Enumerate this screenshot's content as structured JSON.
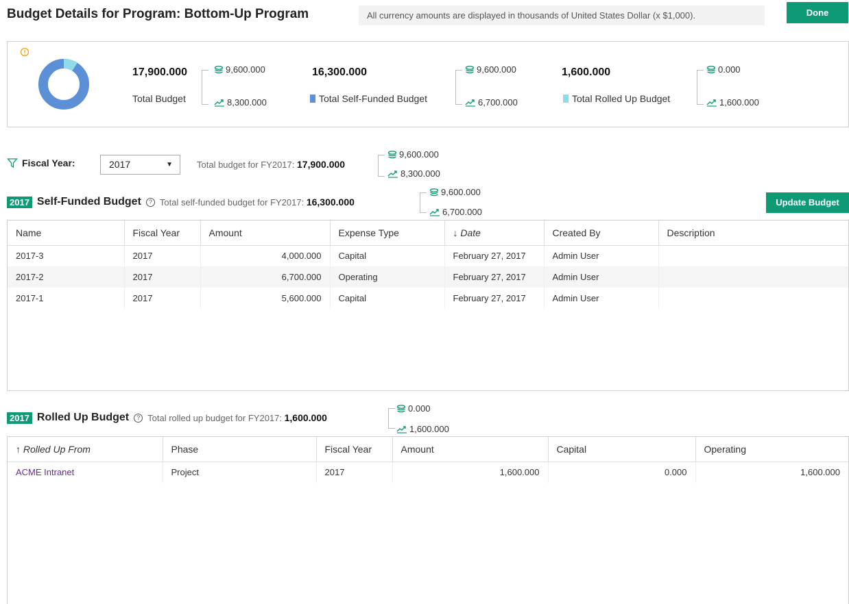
{
  "header": {
    "title": "Budget Details for Program: Bottom-Up Program",
    "currency_note": "All currency amounts are displayed in thousands of United States Dollar (x $1,000).",
    "done_label": "Done"
  },
  "summary": {
    "total": {
      "value": "17,900.000",
      "label": "Total Budget",
      "capital": "9,600.000",
      "operating": "8,300.000"
    },
    "self_funded": {
      "value": "16,300.000",
      "label": "Total Self-Funded Budget",
      "capital": "9,600.000",
      "operating": "6,700.000",
      "color": "#5b8fd6"
    },
    "rolled_up": {
      "value": "1,600.000",
      "label": "Total Rolled Up Budget",
      "capital": "0.000",
      "operating": "1,600.000",
      "color": "#8fdbe8"
    },
    "donut": {
      "self_funded_share": 0.9106,
      "rolled_up_share": 0.0894
    }
  },
  "filter": {
    "label": "Fiscal Year:",
    "selected": "2017",
    "total_text": "Total budget for FY2017:",
    "total_value": "17,900.000",
    "capital": "9,600.000",
    "operating": "8,300.000"
  },
  "self_funded": {
    "badge": "2017",
    "title": "Self-Funded Budget",
    "total_text": "Total self-funded budget for FY2017:",
    "total_value": "16,300.000",
    "capital": "9,600.000",
    "operating": "6,700.000",
    "update_label": "Update Budget",
    "columns": [
      "Name",
      "Fiscal Year",
      "Amount",
      "Expense Type",
      "↓ Date",
      "Created By",
      "Description"
    ],
    "rows": [
      [
        "2017-3",
        "2017",
        "4,000.000",
        "Capital",
        "February 27, 2017",
        "Admin User",
        ""
      ],
      [
        "2017-2",
        "2017",
        "6,700.000",
        "Operating",
        "February 27, 2017",
        "Admin User",
        ""
      ],
      [
        "2017-1",
        "2017",
        "5,600.000",
        "Capital",
        "February 27, 2017",
        "Admin User",
        ""
      ]
    ]
  },
  "rolled_up": {
    "badge": "2017",
    "title": "Rolled Up Budget",
    "total_text": "Total rolled up budget for FY2017:",
    "total_value": "1,600.000",
    "capital": "0.000",
    "operating": "1,600.000",
    "columns": [
      "↑ Rolled Up From",
      "Phase",
      "Fiscal Year",
      "Amount",
      "Capital",
      "Operating"
    ],
    "rows": [
      [
        "ACME Intranet",
        "Project",
        "2017",
        "1,600.000",
        "0.000",
        "1,600.000"
      ]
    ]
  },
  "colors": {
    "accent": "#0f9a76",
    "warning": "#f0a30a",
    "link": "#6a2c8c"
  },
  "icons": {
    "capital": "stack-money-icon",
    "operating": "trend-up-icon",
    "filter": "funnel-icon",
    "warning": "warning-circle-icon",
    "help": "help-circle-icon"
  }
}
